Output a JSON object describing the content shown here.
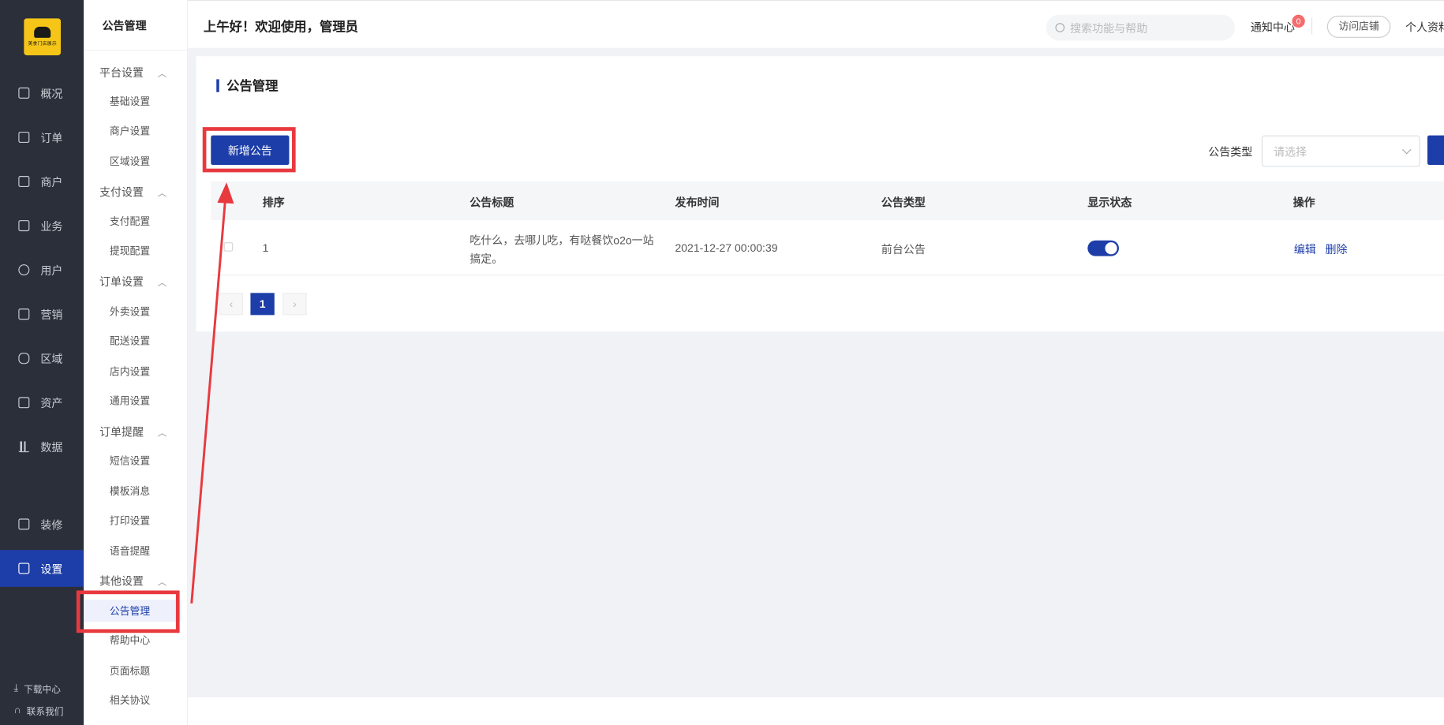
{
  "logo": {
    "text": "美食门店展示"
  },
  "nav": {
    "items": [
      {
        "label": "概况",
        "icon": "presentation-icon"
      },
      {
        "label": "订单",
        "icon": "order-icon"
      },
      {
        "label": "商户",
        "icon": "store-icon"
      },
      {
        "label": "业务",
        "icon": "business-icon"
      },
      {
        "label": "用户",
        "icon": "user-icon"
      },
      {
        "label": "营销",
        "icon": "marketing-icon"
      },
      {
        "label": "区域",
        "icon": "database-icon"
      },
      {
        "label": "资产",
        "icon": "wallet-icon"
      },
      {
        "label": "数据",
        "icon": "bar-chart-icon"
      },
      {
        "label": "装修",
        "icon": "bag-icon"
      },
      {
        "label": "设置",
        "icon": "settings-icon",
        "active": true
      }
    ],
    "download": "下载中心",
    "contact": "联系我们"
  },
  "submenu": {
    "title": "公告管理",
    "groups": [
      {
        "label": "平台设置",
        "items": [
          "基础设置",
          "商户设置",
          "区域设置"
        ]
      },
      {
        "label": "支付设置",
        "items": [
          "支付配置",
          "提现配置"
        ]
      },
      {
        "label": "订单设置",
        "items": [
          "外卖设置",
          "配送设置",
          "店内设置",
          "通用设置"
        ]
      },
      {
        "label": "订单提醒",
        "items": [
          "短信设置",
          "模板消息",
          "打印设置",
          "语音提醒"
        ]
      },
      {
        "label": "其他设置",
        "items": [
          "公告管理",
          "帮助中心",
          "页面标题",
          "相关协议"
        ]
      }
    ],
    "active_item": "公告管理"
  },
  "header": {
    "greeting": "上午好！欢迎使用，管理员",
    "search_placeholder": "搜索功能与帮助",
    "notice_label": "通知中心",
    "notice_count": "0",
    "visit_label": "访问店铺",
    "profile_label": "个人资料"
  },
  "page": {
    "title": "公告管理",
    "add_button": "新增公告",
    "filter_label": "公告类型",
    "filter_placeholder": "请选择"
  },
  "table": {
    "columns": [
      "排序",
      "公告标题",
      "发布时间",
      "公告类型",
      "显示状态",
      "操作"
    ],
    "rows": [
      {
        "order": "1",
        "title_line1": "吃什么，去哪儿吃，有哒餐饮o2o一站",
        "title_line2": "搞定。",
        "time": "2021-12-27 00:00:39",
        "type": "前台公告",
        "status_on": true,
        "edit": "编辑",
        "delete": "删除"
      }
    ]
  },
  "pagination": {
    "prev": "‹",
    "current": "1",
    "next": "›"
  },
  "colors": {
    "primary": "#1d3ea8",
    "sidebar": "#2b2f3a",
    "annotation": "#e8393f",
    "logo": "#f5c518"
  }
}
